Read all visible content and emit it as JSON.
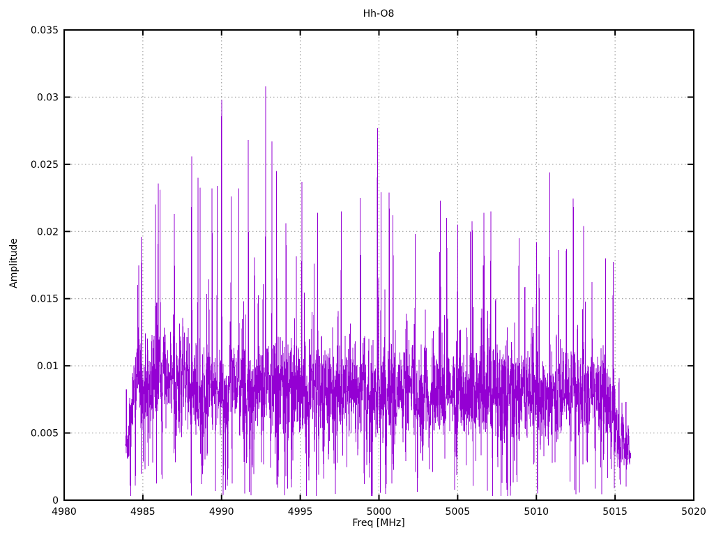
{
  "chart_data": {
    "type": "line",
    "title": "Hh-O8",
    "xlabel": "Freq [MHz]",
    "ylabel": "Amplitude",
    "xlim": [
      4980,
      5020
    ],
    "ylim": [
      0,
      0.035
    ],
    "xtick_values": [
      4980,
      4985,
      4990,
      4995,
      5000,
      5005,
      5010,
      5015,
      5020
    ],
    "xtick_labels": [
      "4980",
      "4985",
      "4990",
      "4995",
      "5000",
      "5005",
      "5010",
      "5015",
      "5020"
    ],
    "ytick_values": [
      0,
      0.005,
      0.01,
      0.015,
      0.02,
      0.025,
      0.03,
      0.035
    ],
    "ytick_labels": [
      "0",
      "0.005",
      "0.01",
      "0.015",
      "0.02",
      "0.025",
      "0.03",
      "0.035"
    ],
    "grid": true,
    "grid_style": "dotted",
    "legend": false,
    "colors": {
      "trace": "#9400d3",
      "grid": "#8a8a8a",
      "axis": "#000000",
      "background": "#ffffff",
      "text": "#000000"
    },
    "signal": {
      "description": "dense noise-like amplitude spectrum occupying 4983.9-5016.0 MHz, noise band ~0.004-0.0125 with frequent spikes to ~0.015-0.022 and rare spikes to ~0.031",
      "x_start": 4983.9,
      "x_end": 5016.0,
      "n_points": 2400,
      "seed": 1337,
      "dip_prob": 0.06,
      "band_low": 0.004,
      "band_high": 0.0125,
      "spike_prob": 0.1,
      "spike_scale": 0.0028,
      "big_spike_prob": 0.018,
      "big_spike_scale": 0.005,
      "random_cap": 0.0235,
      "ramp_in_mhz": 0.7,
      "ramp_out_start": 5014.2,
      "hump_center": 4986.5,
      "hump_width": 1.3,
      "hump_amp": 0.08,
      "tilt": 0.05
    },
    "peaks": [
      [
        4984.9,
        0.0196
      ],
      [
        4985.8,
        0.022
      ],
      [
        4986.1,
        0.0231
      ],
      [
        4987.0,
        0.0213
      ],
      [
        4988.1,
        0.0256
      ],
      [
        4988.5,
        0.024
      ],
      [
        4989.4,
        0.0232
      ],
      [
        4990.0,
        0.0298
      ],
      [
        4990.6,
        0.0226
      ],
      [
        4991.1,
        0.0232
      ],
      [
        4991.7,
        0.0268
      ],
      [
        4992.8,
        0.0308
      ],
      [
        4993.2,
        0.0267
      ],
      [
        4993.5,
        0.0245
      ],
      [
        4994.1,
        0.0206
      ],
      [
        4995.1,
        0.0237
      ],
      [
        4996.1,
        0.0214
      ],
      [
        4997.6,
        0.0215
      ],
      [
        4998.8,
        0.0225
      ],
      [
        4999.9,
        0.0277
      ],
      [
        5000.9,
        0.0212
      ],
      [
        5002.3,
        0.0198
      ],
      [
        5003.9,
        0.0223
      ],
      [
        5004.3,
        0.021
      ],
      [
        5005.0,
        0.0205
      ],
      [
        5005.8,
        0.02
      ],
      [
        5007.1,
        0.0215
      ],
      [
        5008.9,
        0.0195
      ],
      [
        5010.0,
        0.0192
      ],
      [
        5010.85,
        0.0244
      ],
      [
        5011.9,
        0.0187
      ],
      [
        5013.0,
        0.0204
      ],
      [
        5014.4,
        0.018
      ]
    ]
  }
}
